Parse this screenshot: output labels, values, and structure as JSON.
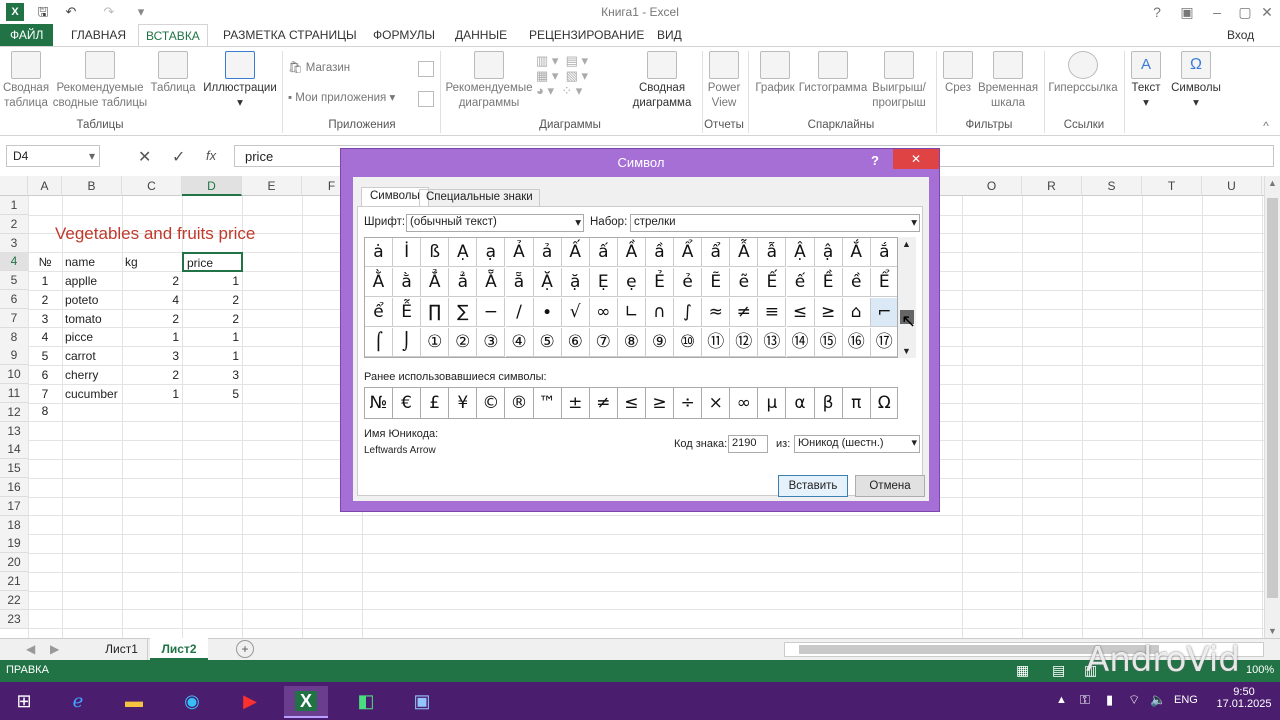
{
  "titlebar": {
    "title": "Книга1 - Excel",
    "help": "?"
  },
  "tabs": [
    {
      "label": "ФАЙЛ"
    },
    {
      "label": "ГЛАВНАЯ"
    },
    {
      "label": "ВСТАВКА"
    },
    {
      "label": "РАЗМЕТКА СТРАНИЦЫ"
    },
    {
      "label": "ФОРМУЛЫ"
    },
    {
      "label": "ДАННЫЕ"
    },
    {
      "label": "РЕЦЕНЗИРОВАНИЕ"
    },
    {
      "label": "ВИД"
    }
  ],
  "signin": "Вход",
  "ribbon": {
    "pivot1": "Сводная",
    "pivot2": "таблица",
    "recpivot1": "Рекомендуемые",
    "recpivot2": "сводные таблицы",
    "table": "Таблица",
    "illus": "Иллюстрации",
    "store": "Магазин",
    "myapps": "Мои приложения",
    "recch1": "Рекомендуемые",
    "recch2": "диаграммы",
    "pivch1": "Сводная",
    "pivch2": "диаграмма",
    "power1": "Power",
    "power2": "View",
    "graph": "График",
    "hist": "Гистограмма",
    "win1": "Выигрыш/",
    "win2": "проигрыш",
    "slicer": "Срез",
    "tl1": "Временная",
    "tl2": "шкала",
    "link": "Гиперссылка",
    "text": "Текст",
    "symbols": "Символы",
    "groups": {
      "tables": "Таблицы",
      "apps": "Приложения",
      "charts": "Диаграммы",
      "reports": "Отчеты",
      "spark": "Спарклайны",
      "filters": "Фильтры",
      "links": "Ссылки"
    }
  },
  "formula": {
    "namebox": "D4",
    "fx": "fx",
    "value": "price"
  },
  "columns": [
    "A",
    "B",
    "C",
    "D",
    "E",
    "F",
    "G",
    "H",
    "I",
    "J",
    "K",
    "L",
    "M",
    "N",
    "O",
    "R",
    "S",
    "T",
    "U"
  ],
  "rows": [
    "1",
    "2",
    "3",
    "4",
    "5",
    "6",
    "7",
    "8",
    "9",
    "10",
    "11",
    "12",
    "13",
    "14",
    "15",
    "16",
    "17",
    "18",
    "19",
    "20",
    "21",
    "22",
    "23"
  ],
  "sheet": {
    "title": "Vegetables and fruits price",
    "headers": {
      "no": "№",
      "name": "name",
      "kg": "kg",
      "price": "price"
    },
    "data": [
      {
        "no": "1",
        "name": "applle",
        "kg": "2",
        "price": "1"
      },
      {
        "no": "2",
        "name": "poteto",
        "kg": "4",
        "price": "2"
      },
      {
        "no": "3",
        "name": "tomato",
        "kg": "2",
        "price": "2"
      },
      {
        "no": "4",
        "name": "picce",
        "kg": "1",
        "price": "1"
      },
      {
        "no": "5",
        "name": "carrot",
        "kg": "3",
        "price": "1"
      },
      {
        "no": "6",
        "name": "cherry",
        "kg": "2",
        "price": "3"
      },
      {
        "no": "7",
        "name": "cucumber",
        "kg": "1",
        "price": "5"
      }
    ],
    "row12": "8"
  },
  "sheettabs": [
    "Лист1",
    "Лист2"
  ],
  "status": {
    "ready": "ПРАВКА",
    "zoom": "100%"
  },
  "dialog": {
    "title": "Символ",
    "help": "?",
    "close": "✕",
    "tab1": "Символы",
    "tab2": "Специальные знаки",
    "font_label": "Шрифт:",
    "font_value": "(обычный текст)",
    "set_label": "Набор:",
    "set_value": "стрелки",
    "symbols": [
      [
        "ȧ",
        "İ",
        "ß",
        "Ạ",
        "ạ",
        "Ả",
        "ả",
        "Ấ",
        "ấ",
        "Ầ",
        "ầ",
        "Ẩ",
        "ẩ",
        "Ẫ",
        "ẫ",
        "Ậ",
        "ậ",
        "Ắ",
        "ắ"
      ],
      [
        "Ằ",
        "ằ",
        "Ẳ",
        "ẳ",
        "Ẵ",
        "ẵ",
        "Ặ",
        "ặ",
        "Ẹ",
        "ẹ",
        "Ẻ",
        "ẻ",
        "Ẽ",
        "ẽ",
        "Ế",
        "ế",
        "Ề",
        "ề",
        "Ể"
      ],
      [
        "ể",
        "Ễ",
        "∏",
        "∑",
        "−",
        "∕",
        "∙",
        "√",
        "∞",
        "∟",
        "∩",
        "∫",
        "≈",
        "≠",
        "≡",
        "≤",
        "≥",
        "⌂",
        "⌐"
      ],
      [
        "⌠",
        "⌡",
        "①",
        "②",
        "③",
        "④",
        "⑤",
        "⑥",
        "⑦",
        "⑧",
        "⑨",
        "⑩",
        "⑪",
        "⑫",
        "⑬",
        "⑭",
        "⑮",
        "⑯",
        "⑰"
      ]
    ],
    "recent_label": "Ранее использовавшиеся символы:",
    "recent": [
      "№",
      "€",
      "£",
      "¥",
      "©",
      "®",
      "™",
      "±",
      "≠",
      "≤",
      "≥",
      "÷",
      "×",
      "∞",
      "µ",
      "α",
      "β",
      "π",
      "Ω"
    ],
    "unicode_name_label": "Имя Юникода:",
    "unicode_name": "Leftwards Arrow",
    "code_label": "Код знака:",
    "code_value": "2190",
    "from_label": "из:",
    "from_value": "Юникод (шестн.)",
    "insert": "Вставить",
    "cancel": "Отмена"
  },
  "taskbar": {
    "lang": "ENG",
    "time": "9:50",
    "date": "17.01.2025"
  },
  "watermark": "AndroVid"
}
